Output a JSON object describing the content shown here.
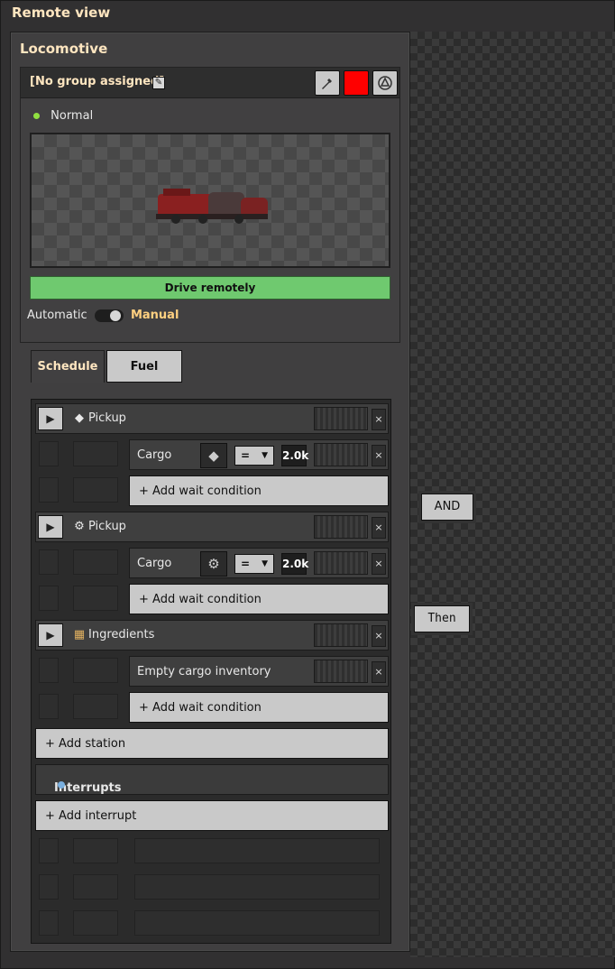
{
  "window": {
    "title": "Remote view"
  },
  "panel": {
    "title": "Locomotive"
  },
  "group": {
    "label": "[No group assigned]"
  },
  "status": {
    "text": "Normal"
  },
  "drive_button": "Drive remotely",
  "mode": {
    "automatic": "Automatic",
    "manual": "Manual"
  },
  "tabs": {
    "schedule": "Schedule",
    "fuel": "Fuel"
  },
  "schedule": {
    "stations": [
      {
        "name": "Pickup",
        "icon": "plate-icon",
        "condition": {
          "label": "Cargo",
          "comparator": "=",
          "value": "2.0k"
        }
      },
      {
        "name": "Pickup",
        "icon": "gear-icon",
        "condition": {
          "label": "Cargo",
          "comparator": "=",
          "value": "2.0k"
        }
      },
      {
        "name": "Ingredients",
        "icon": "ingredients-icon",
        "condition": {
          "label": "Empty cargo inventory"
        }
      }
    ],
    "add_wait_condition": "+ Add wait condition",
    "add_station": "+ Add station",
    "interrupts": "Interrupts",
    "add_interrupt": "+ Add interrupt"
  },
  "floating": {
    "and": "AND",
    "then": "Then"
  },
  "colors": {
    "train_color": "#ff0000",
    "drive_green": "#6fc96f",
    "title": "#ffe6c0"
  }
}
